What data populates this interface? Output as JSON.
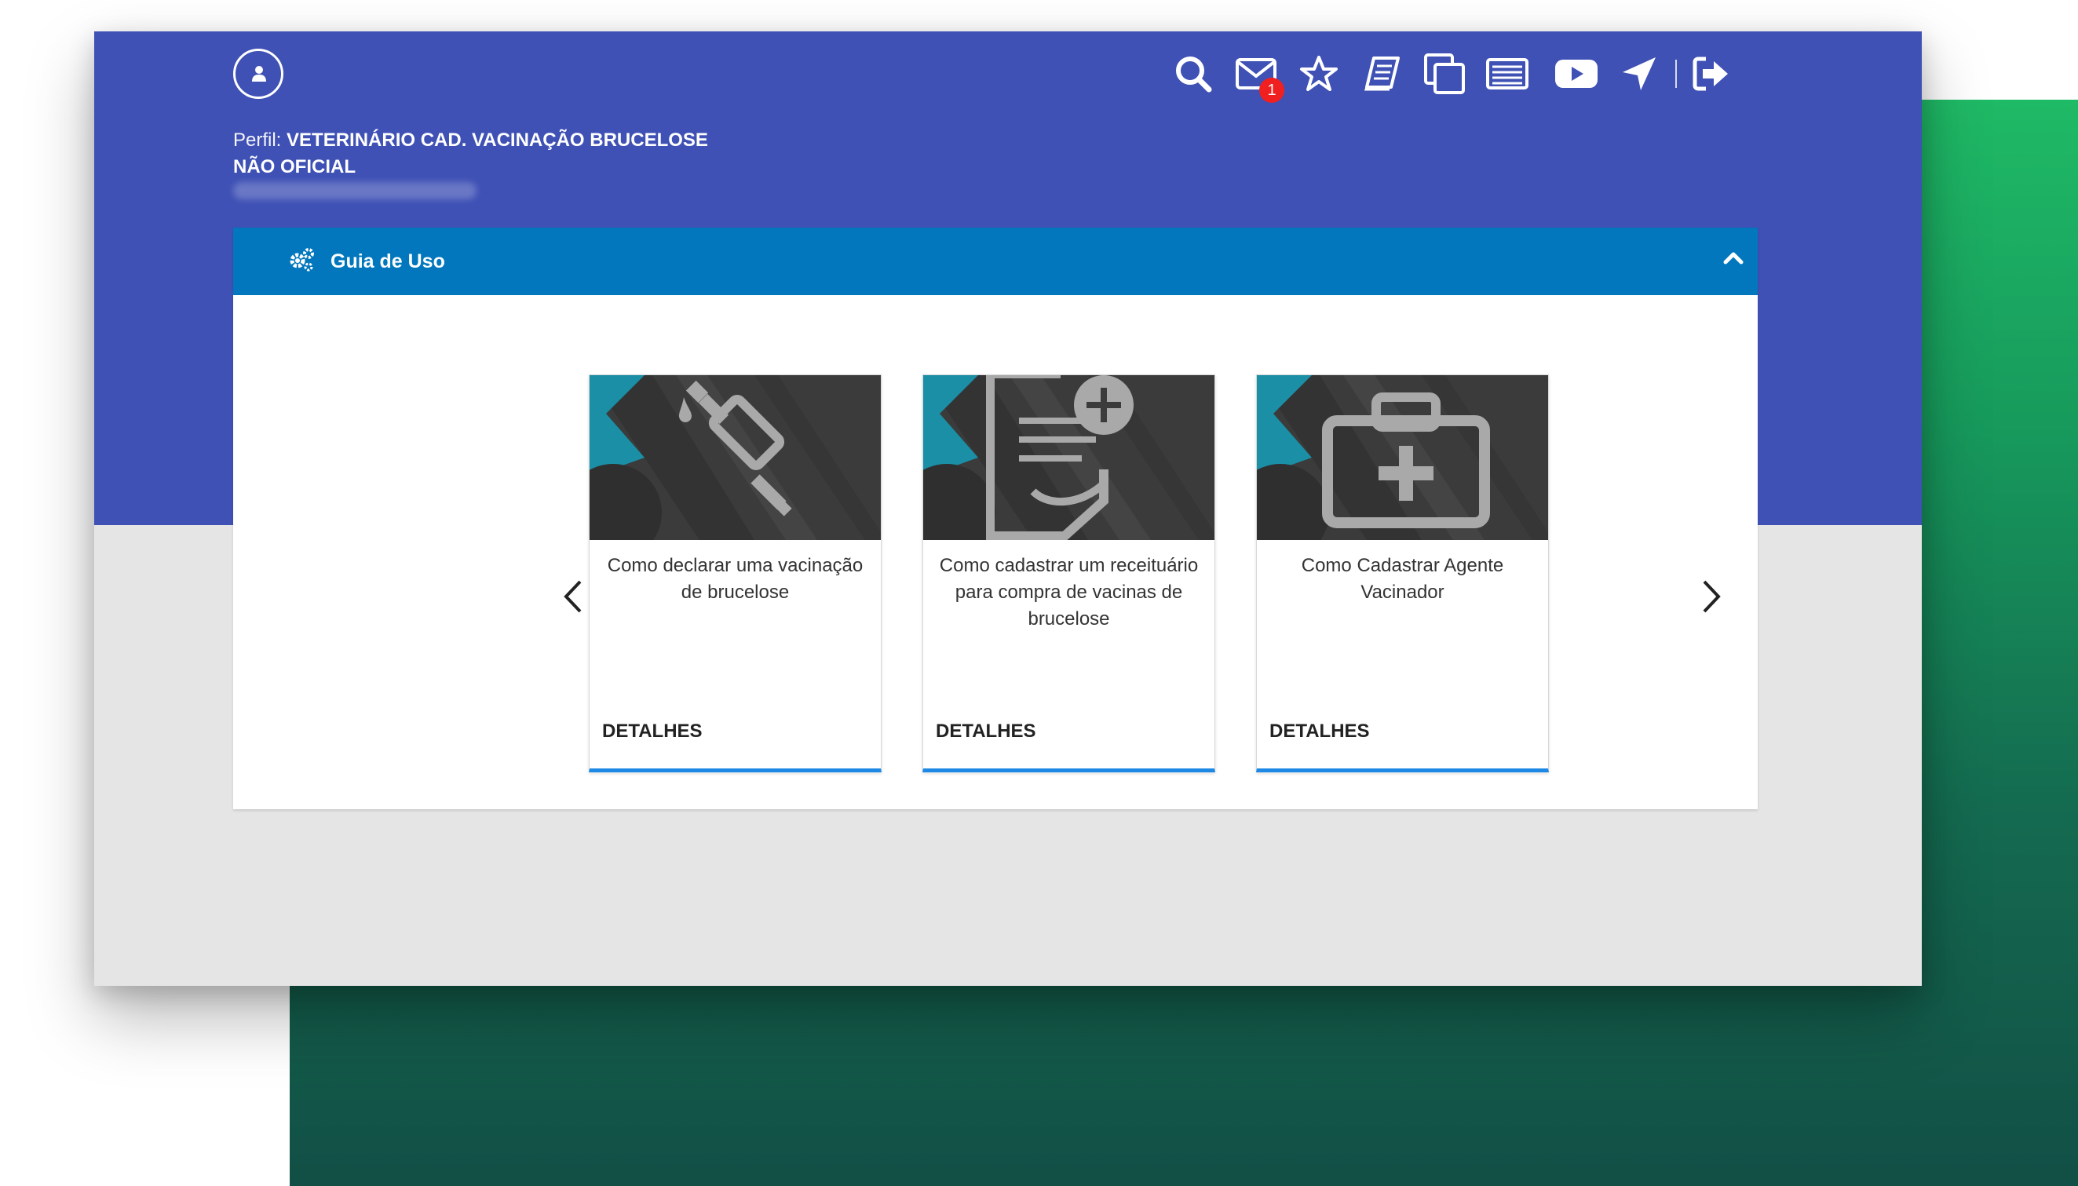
{
  "profile": {
    "label": "Perfil: ",
    "name": "VETERINÁRIO CAD. VACINAÇÃO BRUCELOSE NÃO OFICIAL"
  },
  "toolbar": {
    "icons": [
      "search-icon",
      "mail-icon",
      "star-icon",
      "book-icon",
      "copy-icon",
      "list-icon",
      "youtube-icon",
      "navigation-icon",
      "logout-icon"
    ],
    "mail_badge": "1"
  },
  "guide": {
    "title": "Guia de Uso",
    "icon": "gears-icon",
    "toggle_icon": "chevron-up-icon"
  },
  "carousel": {
    "prev_icon": "chevron-left-icon",
    "next_icon": "chevron-right-icon",
    "cards": [
      {
        "title": "Como declarar uma vacinação de brucelose",
        "action": "DETALHES",
        "icon": "syringe-icon"
      },
      {
        "title": "Como cadastrar um receituário para compra de vacinas de brucelose",
        "action": "DETALHES",
        "icon": "prescription-icon"
      },
      {
        "title": "Como Cadastrar Agente Vacinador",
        "action": "DETALHES",
        "icon": "medical-kit-icon"
      }
    ]
  },
  "colors": {
    "header": "#3f51b5",
    "panel_header": "#0277bd",
    "card_accent": "#1e88e5",
    "badge": "#f02020",
    "background_green": "#1fba66"
  }
}
